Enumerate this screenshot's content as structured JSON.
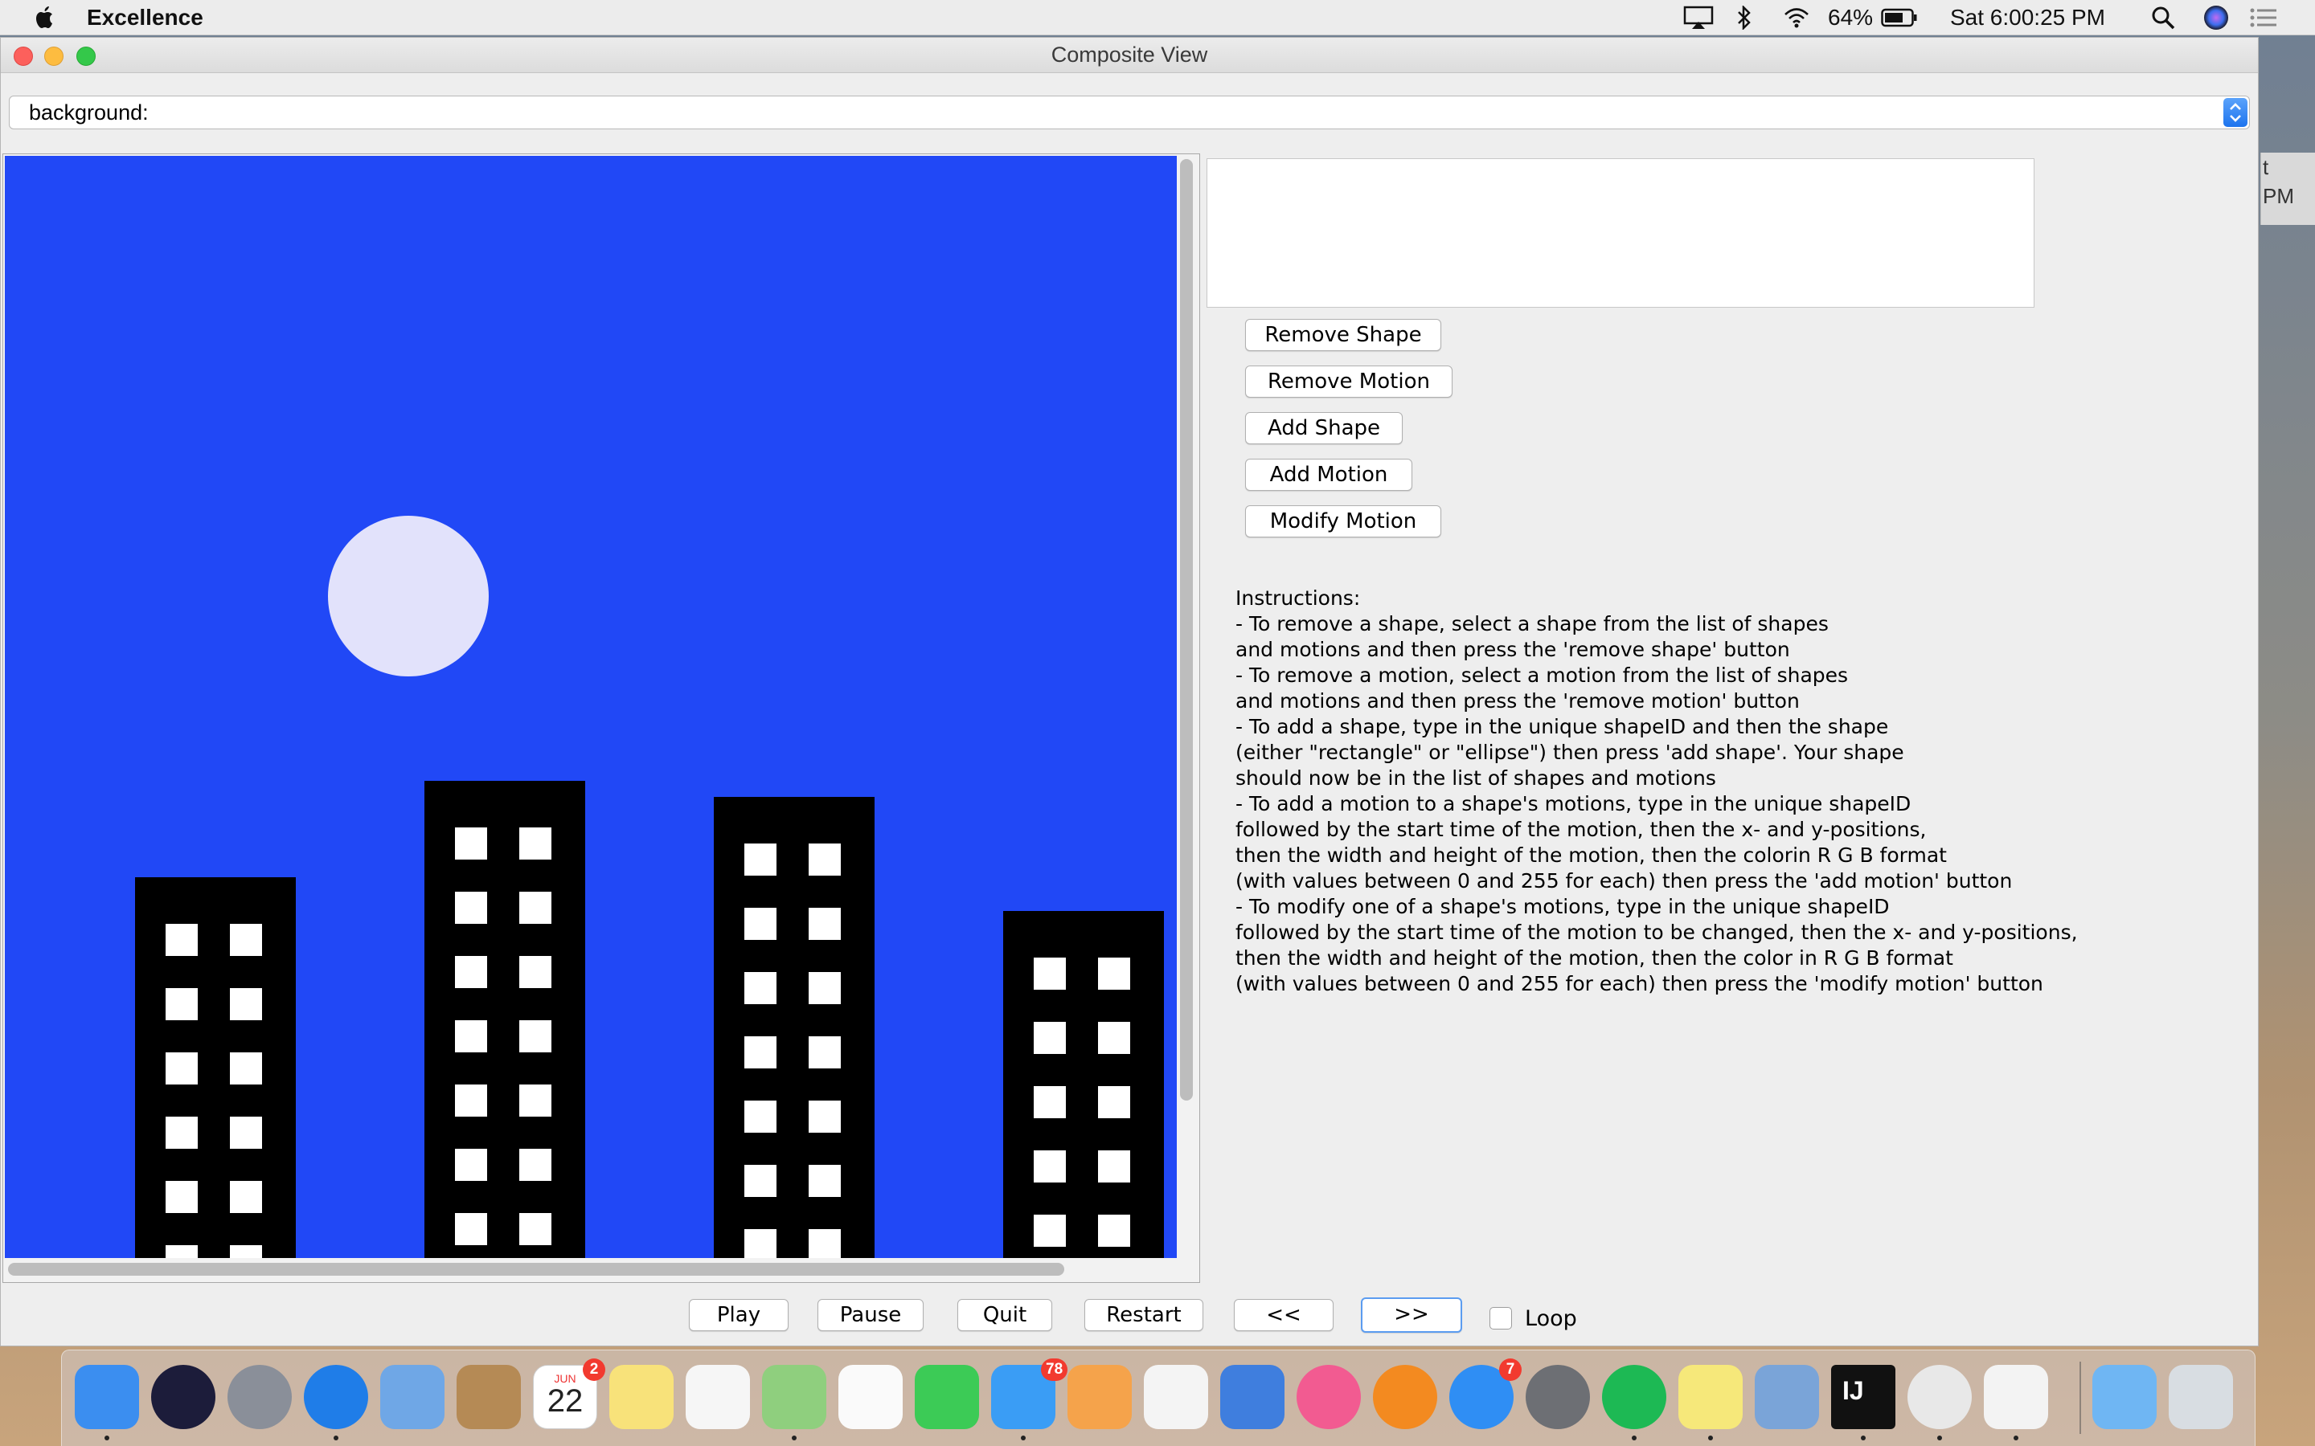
{
  "menubar": {
    "app_name": "Excellence",
    "battery": "64%",
    "clock": "Sat 6:00:25 PM"
  },
  "window": {
    "title": "Composite View",
    "background_combo_value": "background:"
  },
  "canvas": {
    "sky_color": "#2148f6",
    "moon_color": "#e2e2fb",
    "building_color": "#000000",
    "window_color": "#ffffff"
  },
  "buttons": {
    "remove_shape": "Remove Shape",
    "remove_motion": "Remove Motion",
    "add_shape": "Add Shape",
    "add_motion": "Add Motion",
    "modify_motion": "Modify Motion"
  },
  "instructions": [
    "Instructions:",
    "- To remove a shape, select a shape from the list of shapes",
    "and motions and then press the 'remove shape' button",
    "- To remove a motion, select a motion from the list of shapes",
    "and motions and then press the 'remove motion' button",
    "- To add a shape, type in the unique shapeID and then the shape",
    "(either \"rectangle\" or \"ellipse\") then press 'add shape'. Your shape",
    "should now be in the list of shapes and motions",
    "- To add a motion to a shape's motions, type in the unique shapeID",
    "followed by the start time of the motion, then the x- and y-positions,",
    "then the width and height of the motion, then the colorin R G B format",
    "(with values between 0 and 255 for each) then press the 'add motion' button",
    "- To modify one of a shape's motions, type in the unique shapeID",
    "followed by the start time of the motion to be changed, then the x- and y-positions,",
    "then the width and height of the motion, then the color in R G B format",
    "(with values between 0 and 255 for each) then press the 'modify motion' button"
  ],
  "controls": {
    "play": "Play",
    "pause": "Pause",
    "quit": "Quit",
    "restart": "Restart",
    "rewind": "<<",
    "fast_forward": ">>",
    "loop_label": "Loop",
    "loop_checked": false
  },
  "behind_window_text": [
    "t",
    "PM"
  ],
  "dock": {
    "calendar_month": "JUN",
    "calendar_day": "22",
    "badges": {
      "calendar": "2",
      "messages": "78",
      "app_store": "7"
    },
    "intellij_label": "IJ",
    "items": [
      {
        "name": "finder-icon",
        "color": "#3b8ef0",
        "running": true
      },
      {
        "name": "siri-icon",
        "color": "#1c1c3a",
        "running": false
      },
      {
        "name": "launchpad-icon",
        "color": "#8a8f99",
        "running": false
      },
      {
        "name": "safari-icon",
        "color": "#1f7de8",
        "running": true
      },
      {
        "name": "mail-icon",
        "color": "#6fa7e6",
        "running": false
      },
      {
        "name": "contacts-icon",
        "color": "#b58a55",
        "running": false
      },
      {
        "name": "calendar-icon",
        "color": "#ffffff",
        "running": false
      },
      {
        "name": "notes-icon",
        "color": "#f8e27a",
        "running": false
      },
      {
        "name": "reminders-icon",
        "color": "#f6f6f6",
        "running": false
      },
      {
        "name": "maps-icon",
        "color": "#8fcf7e",
        "running": true
      },
      {
        "name": "photos-icon",
        "color": "#fafafa",
        "running": false
      },
      {
        "name": "facetime-icon",
        "color": "#3ccb56",
        "running": false
      },
      {
        "name": "messages-icon",
        "color": "#3a9df5",
        "running": true
      },
      {
        "name": "pages-icon",
        "color": "#f5a34b",
        "running": false
      },
      {
        "name": "numbers-icon",
        "color": "#f4f4f4",
        "running": false
      },
      {
        "name": "keynote-icon",
        "color": "#3f7ede",
        "running": false
      },
      {
        "name": "itunes-icon",
        "color": "#f25b91",
        "running": false
      },
      {
        "name": "ibooks-icon",
        "color": "#f38a20",
        "running": false
      },
      {
        "name": "app-store-icon",
        "color": "#2f8ef4",
        "running": false
      },
      {
        "name": "system-preferences-icon",
        "color": "#6d6f74",
        "running": false
      },
      {
        "name": "spotify-icon",
        "color": "#1db954",
        "running": true
      },
      {
        "name": "stickies-icon",
        "color": "#f6e87a",
        "running": true
      },
      {
        "name": "preview-icon",
        "color": "#7aa4d8",
        "running": false
      },
      {
        "name": "intellij-icon",
        "color": "#111111",
        "running": true
      },
      {
        "name": "chrome-icon",
        "color": "#e8e8e8",
        "running": true
      },
      {
        "name": "java-icon",
        "color": "#f3f3f3",
        "running": true
      },
      {
        "name": "downloads-folder-icon",
        "color": "#6fb6f3",
        "running": false
      },
      {
        "name": "trash-icon",
        "color": "#d8dde2",
        "running": false
      }
    ]
  }
}
